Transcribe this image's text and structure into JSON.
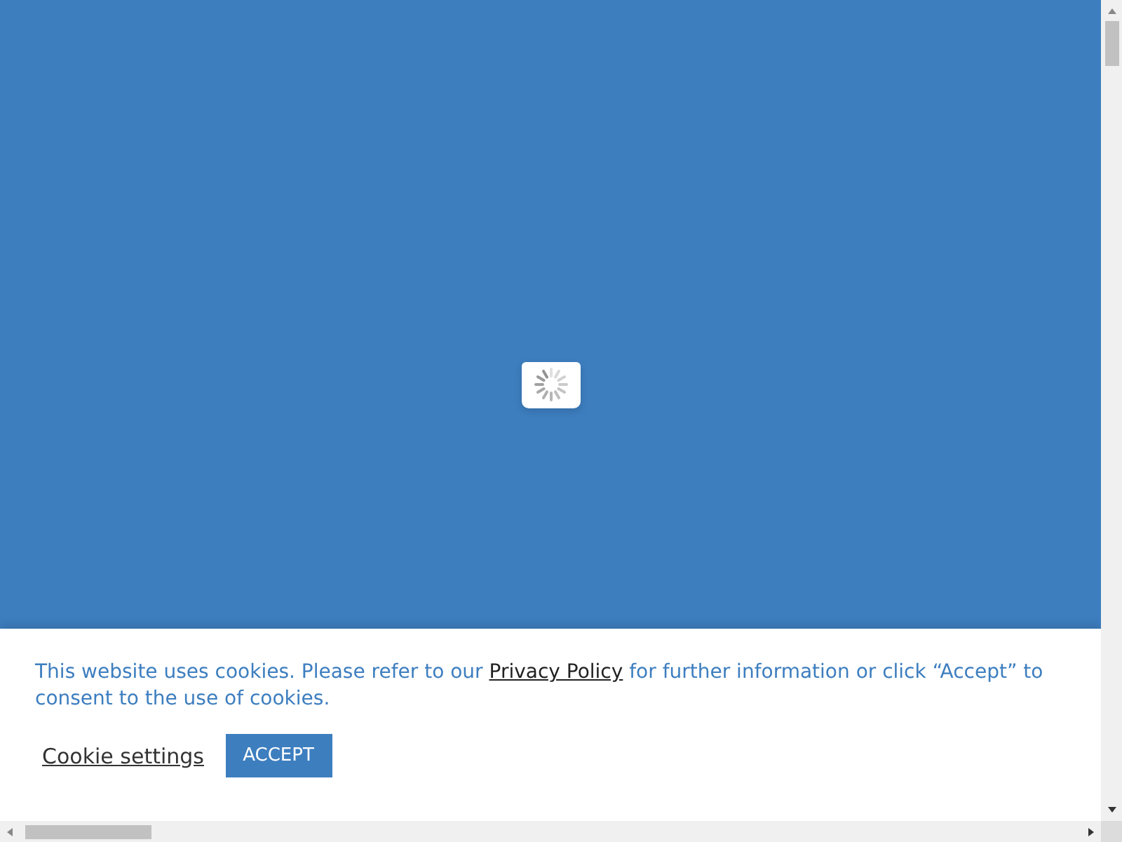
{
  "loader": {
    "kind": "spinner"
  },
  "cookie_banner": {
    "text_before": "This website uses cookies. Please refer to our ",
    "link": "Privacy Policy",
    "text_after": " for further information or click “Accept” to consent to the use of cookies.",
    "settings_link": "Cookie settings",
    "accept_button": "ACCEPT"
  }
}
